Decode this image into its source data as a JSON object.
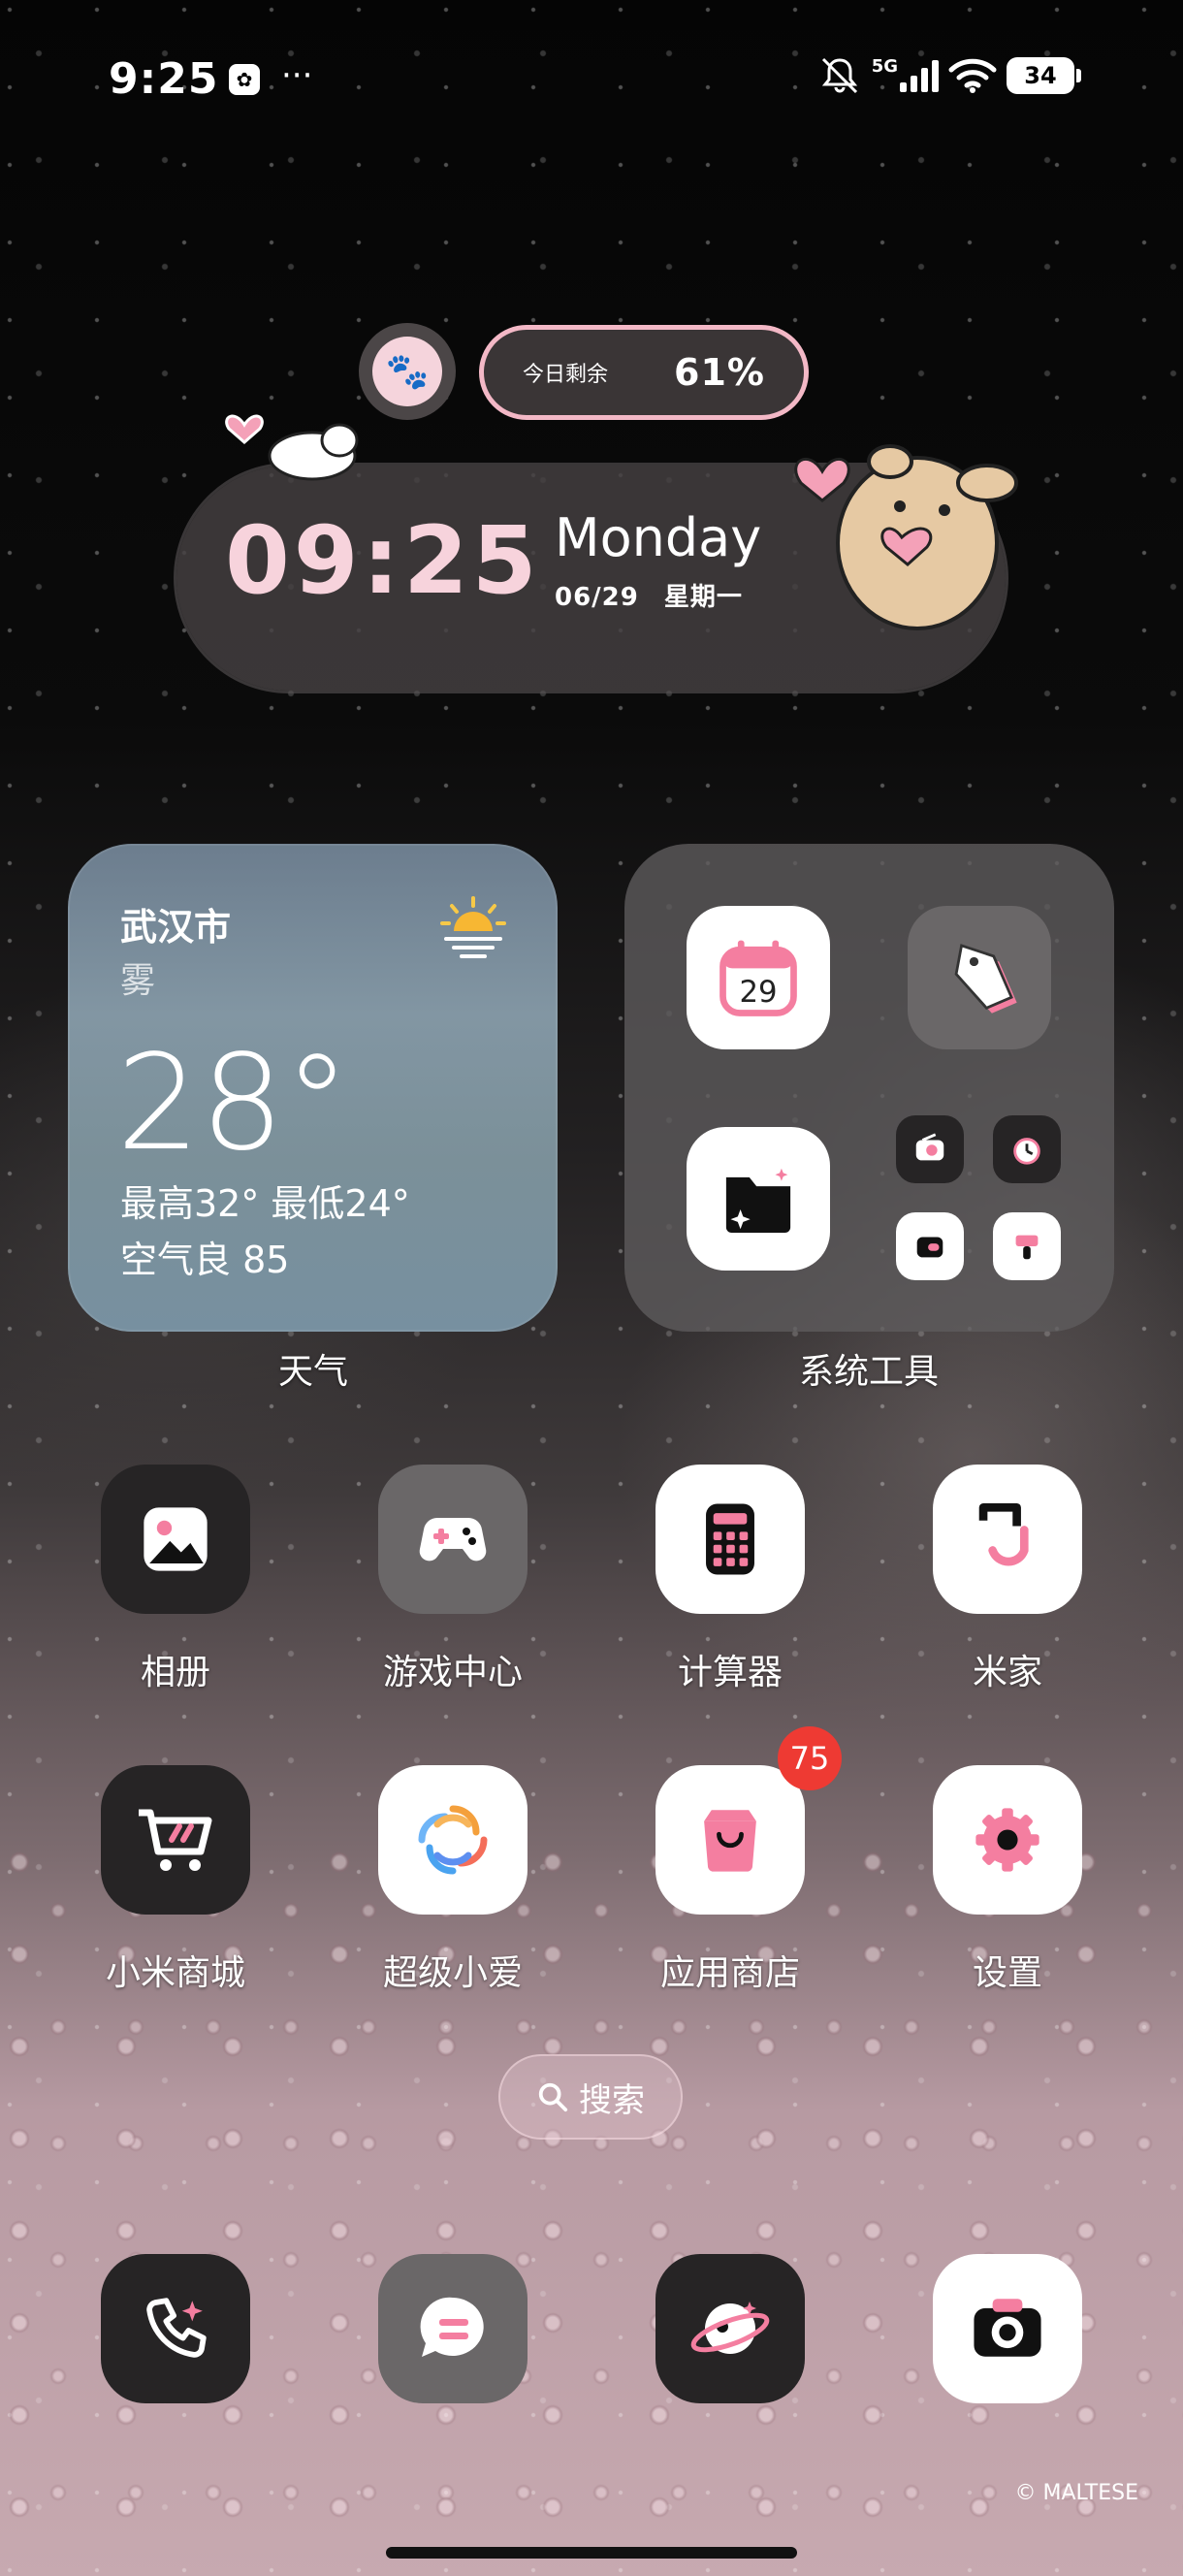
{
  "status": {
    "time": "9:25",
    "network": "5G",
    "battery": "34"
  },
  "remaining_widget": {
    "label": "今日剩余",
    "percent": "61%"
  },
  "clock_widget": {
    "time": "09:25",
    "weekday_en": "Monday",
    "date": "06/29",
    "weekday_cn": "星期一"
  },
  "weather_widget": {
    "city": "武汉市",
    "condition": "雾",
    "temperature": "28°",
    "range": "最高32° 最低24°",
    "air": "空气良 85",
    "label": "天气"
  },
  "tools_widget": {
    "calendar_day": "29",
    "label": "系统工具"
  },
  "apps": {
    "gallery": "相册",
    "game_center": "游戏中心",
    "calculator": "计算器",
    "mi_home": "米家",
    "mi_store": "小米商城",
    "xiaoai": "超级小爱",
    "app_store": "应用商店",
    "settings": "设置",
    "app_store_badge": "75"
  },
  "search": {
    "label": "搜索"
  },
  "watermark": "© MALTESE",
  "colors": {
    "accent_pink": "#f7a7bc",
    "badge_red": "#ee3a33"
  }
}
